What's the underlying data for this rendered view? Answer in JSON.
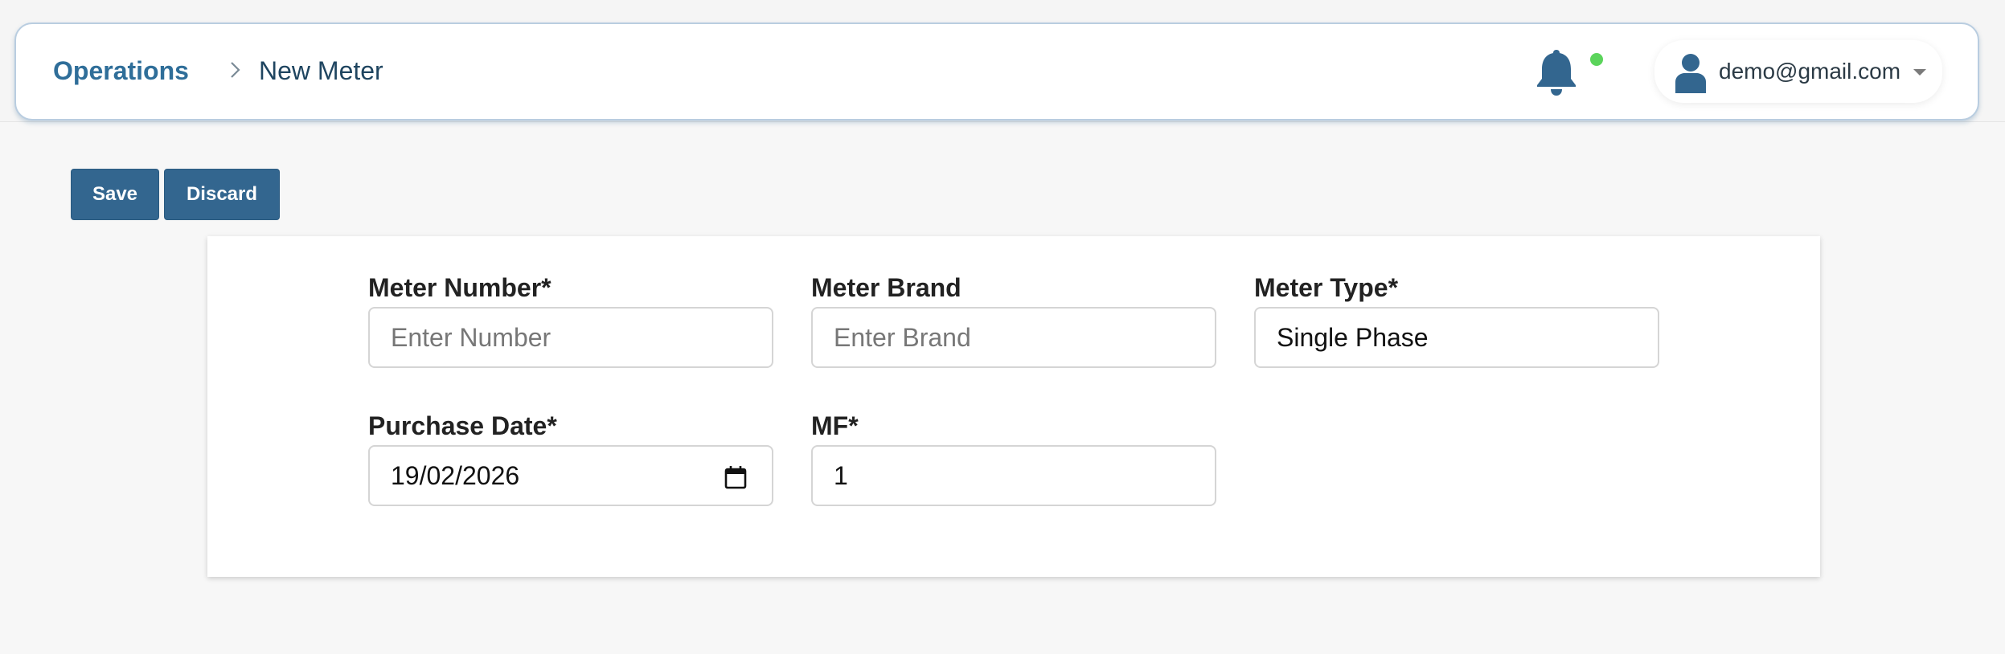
{
  "header": {
    "breadcrumb_root": "Operations",
    "breadcrumb_current": "New Meter",
    "user_email": "demo@gmail.com",
    "notification_dot_color": "#5bd45b",
    "accent_color": "#33668f"
  },
  "toolbar": {
    "save_label": "Save",
    "discard_label": "Discard"
  },
  "form": {
    "meter_number": {
      "label": "Meter Number*",
      "placeholder": "Enter Number",
      "value": ""
    },
    "meter_brand": {
      "label": "Meter Brand",
      "placeholder": "Enter Brand",
      "value": ""
    },
    "meter_type": {
      "label": "Meter Type*",
      "value": "Single Phase"
    },
    "purchase_date": {
      "label": "Purchase Date*",
      "value": "19/02/2026"
    },
    "mf": {
      "label": "MF*",
      "value": "1"
    }
  },
  "icons": {
    "chevron": "chevron-right-icon",
    "bell": "bell-icon",
    "user": "user-icon",
    "calendar": "calendar-icon",
    "caret": "caret-down-icon"
  }
}
